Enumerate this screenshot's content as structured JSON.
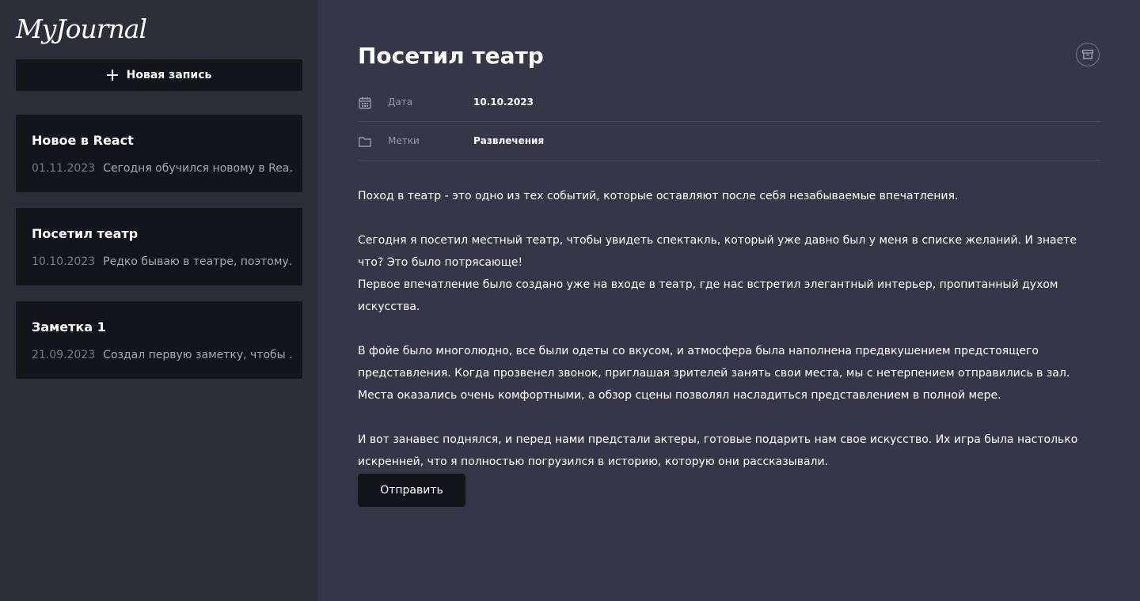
{
  "app": {
    "logo_text": "MyJournal"
  },
  "sidebar": {
    "new_entry_label": "Новая запись",
    "entries": [
      {
        "title": "Новое в React",
        "date": "01.11.2023",
        "preview": "Сегодня обучился новому в Rea..."
      },
      {
        "title": "Посетил театр",
        "date": "10.10.2023",
        "preview": "Редко бываю в театре, поэтому..."
      },
      {
        "title": "Заметка 1",
        "date": "21.09.2023",
        "preview": "Создал первую заметку, чтобы ..."
      }
    ]
  },
  "post": {
    "title": "Посетил театр",
    "date_label": "Дата",
    "date_value": "10.10.2023",
    "tags_label": "Метки",
    "tags_value": "Развлечения",
    "body": "Поход в театр - это одно из тех событий, которые оставляют после себя незабываемые впечатления.\n\nСегодня я посетил местный театр, чтобы увидеть спектакль, который уже давно был у меня в списке желаний. И знаете что? Это было потрясающе!\nПервое впечатление было создано уже на входе в театр, где нас встретил элегантный интерьер, пропитанный духом искусства.\n\nВ фойе было многолюдно, все были одеты со вкусом, и атмосфера была наполнена предвкушением предстоящего представления. Когда прозвенел звонок, приглашая зрителей занять свои места, мы с нетерпением отправились в зал. Места оказались очень комфортными, а обзор сцены позволял насладиться представлением в полной мере.\n\nИ вот занавес поднялся, и перед нами предстали актеры, готовые подарить нам свое искусство. Их игра была настолько искренней, что я полностью погрузился в историю, которую они рассказывали.",
    "submit_label": "Отправить"
  },
  "icons": {
    "new_entry": "plus-icon",
    "archive": "archive-icon",
    "date": "calendar-icon",
    "tags": "folder-icon"
  },
  "colors": {
    "sidebar_bg": "#2e2e3a",
    "main_bg": "#363646",
    "card_bg": "#14141b",
    "text": "#ffffff",
    "muted_text": "#7a7a85"
  }
}
